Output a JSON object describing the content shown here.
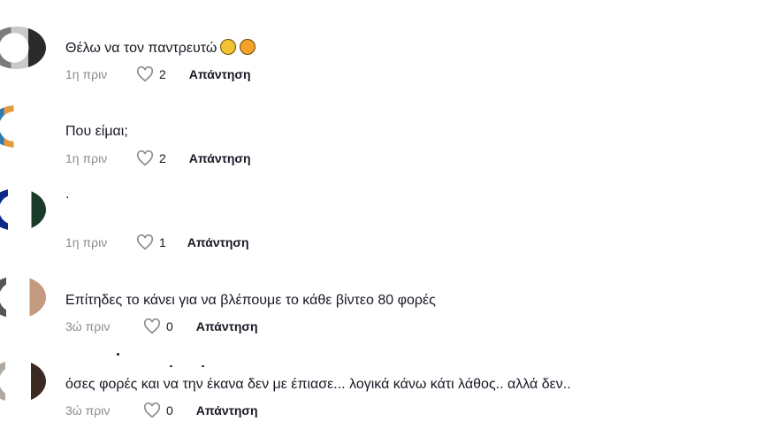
{
  "comments": [
    {
      "text": "Θέλω να τον παντρευτώ",
      "emojis": [
        "grinning-sweat-emoji",
        "smiling-hearts-emoji"
      ],
      "time": "1η πριν",
      "likes": "2",
      "reply": "Απάντηση"
    },
    {
      "text": "Που είμαι;",
      "time": "1η πριν",
      "likes": "2",
      "reply": "Απάντηση"
    },
    {
      "text": ".",
      "time": "1η πριν",
      "likes": "1",
      "reply": "Απάντηση"
    },
    {
      "text": "Επίτηδες το κάνει για να βλέπουμε το κάθε βίντεο 80 φορές",
      "time": "3ώ πριν",
      "likes": "0",
      "reply": "Απάντηση"
    },
    {
      "text": "όσες φορές και να την έκανα δεν με έπιασε... λογικά κάνω κάτι λάθος.. αλλά δεν..",
      "time": "3ώ πριν",
      "likes": "0",
      "reply": "Απάντηση"
    }
  ],
  "icons": {
    "like": "heart-outline-icon"
  },
  "colors": {
    "text": "#161823",
    "meta": "#8a8b91"
  }
}
